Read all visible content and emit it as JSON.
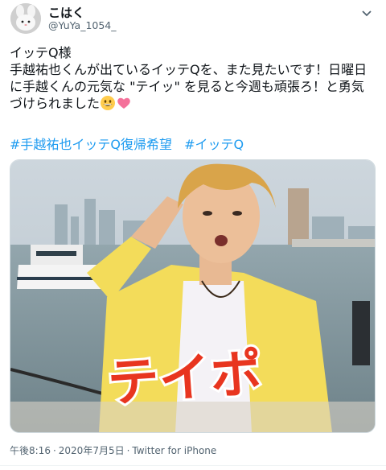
{
  "author": {
    "display_name": "こはく",
    "handle": "@YuYa_1054_"
  },
  "tweet": {
    "text": "イッテQ様\n手越祐也くんが出ているイッテQを、また見たいです！日曜日に手越くんの元気な \"テイッ\" を見ると今週も頑張ろ！と勇気づけられました",
    "emojis": [
      "grinning-face",
      "pink-heart"
    ],
    "hashtags": [
      "#手越祐也イッテQ復帰希望",
      "#イッテQ"
    ]
  },
  "media": {
    "caption_text": "テイポ",
    "caption_fill": "#e8351f",
    "caption_stroke": "#ffffff"
  },
  "meta": {
    "time": "午後8:16",
    "separator1": "·",
    "date": "2020年7月5日",
    "separator2": "·",
    "client": "Twitter for iPhone"
  },
  "colors": {
    "link": "#1d9bf0",
    "secondary_text": "#536471"
  }
}
